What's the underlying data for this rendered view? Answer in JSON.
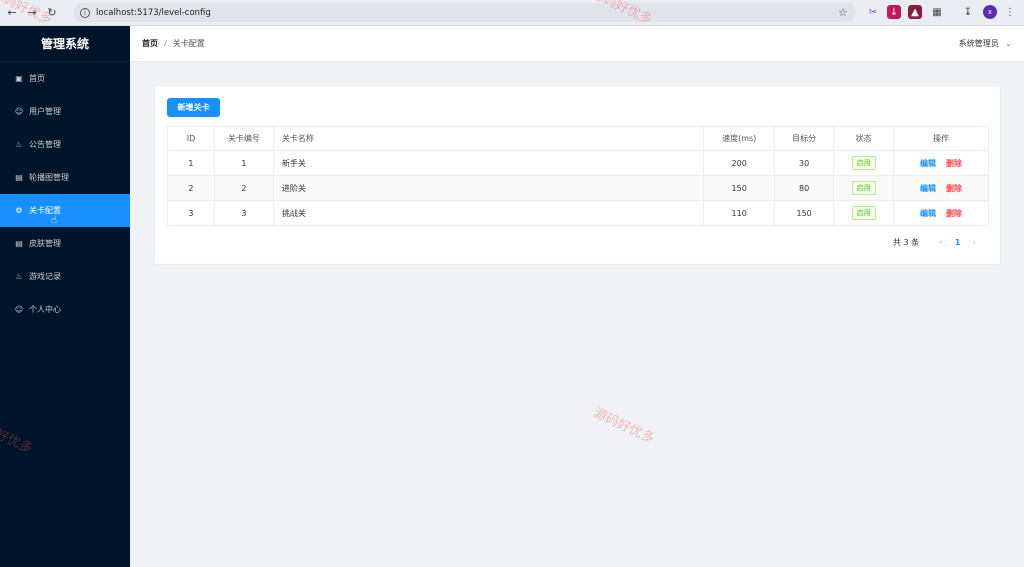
{
  "browser": {
    "url": "localhost:5173/level-config"
  },
  "sidebar": {
    "title": "管理系统",
    "items": [
      {
        "label": "首页",
        "icon": "home-icon"
      },
      {
        "label": "用户管理",
        "icon": "user-icon"
      },
      {
        "label": "公告管理",
        "icon": "bell-icon"
      },
      {
        "label": "轮播图管理",
        "icon": "image-icon"
      },
      {
        "label": "关卡配置",
        "icon": "gear-icon",
        "active": true
      },
      {
        "label": "皮肤管理",
        "icon": "image-icon"
      },
      {
        "label": "游戏记录",
        "icon": "bell-icon"
      },
      {
        "label": "个人中心",
        "icon": "user-icon"
      }
    ]
  },
  "header": {
    "breadcrumb_home": "首页",
    "breadcrumb_sep": "/",
    "breadcrumb_current": "关卡配置",
    "user": "系统管理员"
  },
  "toolbar": {
    "add_label": "新增关卡"
  },
  "table": {
    "columns": [
      "ID",
      "关卡编号",
      "关卡名称",
      "速度(ms)",
      "目标分",
      "状态",
      "操作"
    ],
    "rows": [
      {
        "id": "1",
        "no": "1",
        "name": "新手关",
        "speed": "200",
        "target": "30",
        "status": "启用"
      },
      {
        "id": "2",
        "no": "2",
        "name": "进阶关",
        "speed": "150",
        "target": "80",
        "status": "启用"
      },
      {
        "id": "3",
        "no": "3",
        "name": "挑战关",
        "speed": "110",
        "target": "150",
        "status": "启用"
      }
    ],
    "edit_label": "编辑",
    "delete_label": "删除"
  },
  "pagination": {
    "total": "共 3 条",
    "current_page": "1"
  },
  "watermark": "源码好优多",
  "colors": {
    "primary": "#1890ff",
    "sidebar_bg": "#001529",
    "danger": "#ff4d4f",
    "success": "#52c41a"
  }
}
